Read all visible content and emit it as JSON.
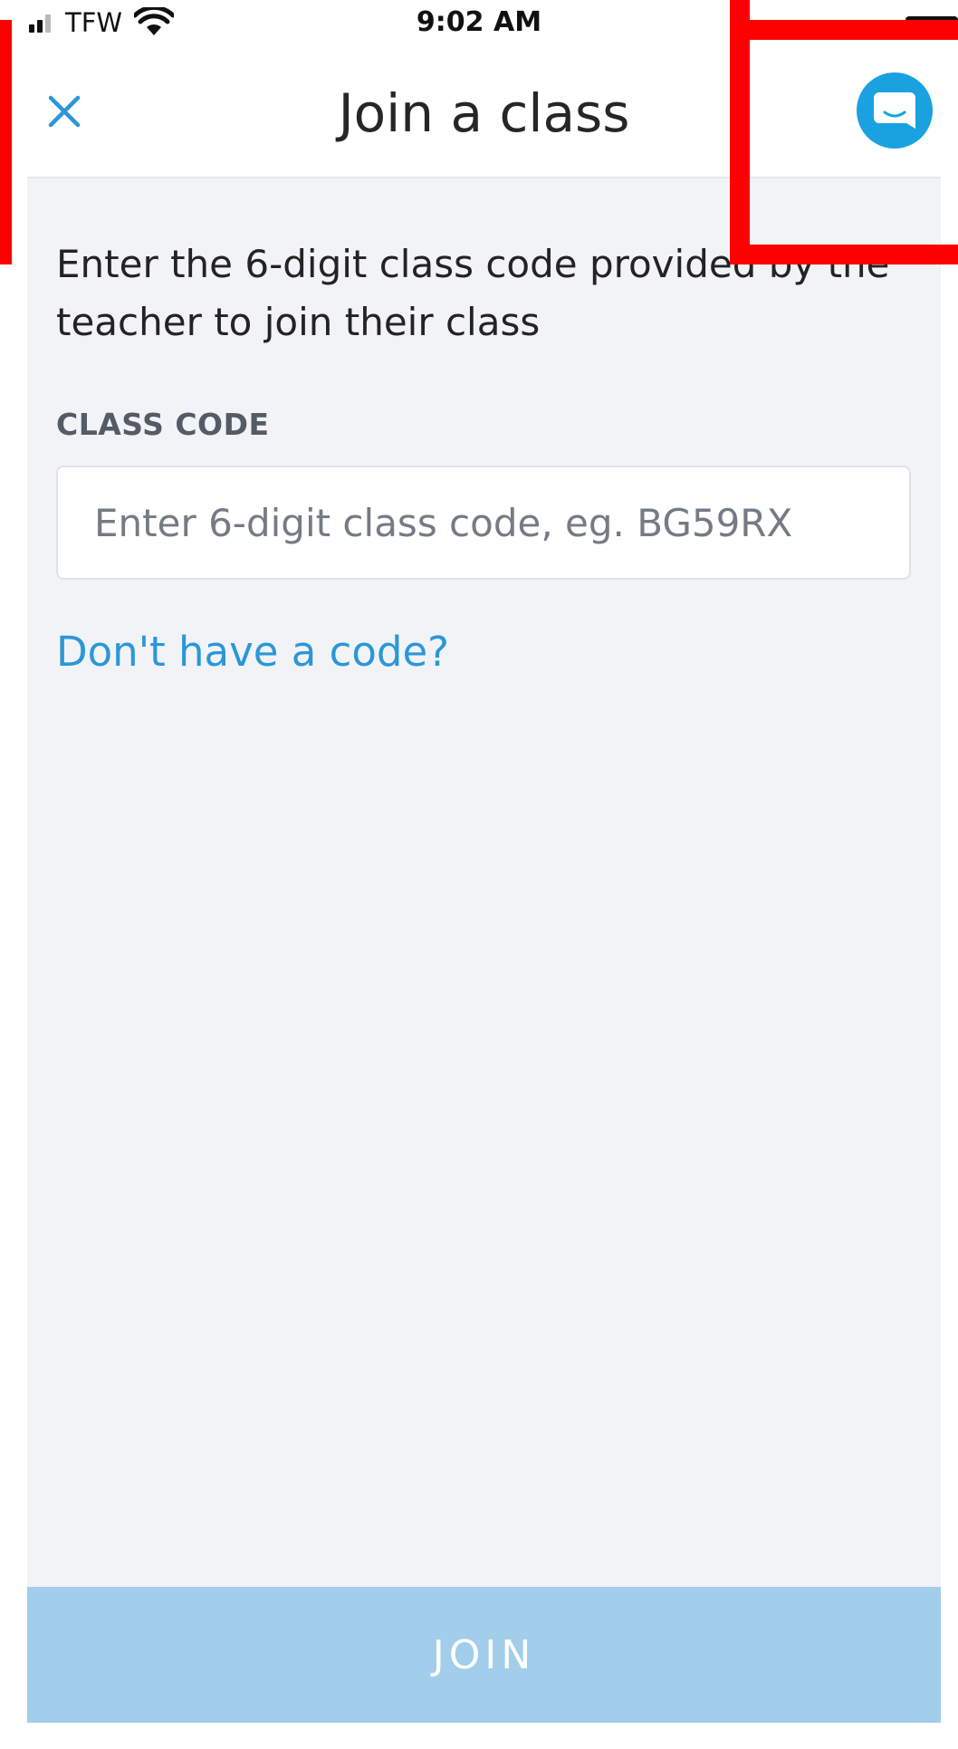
{
  "status_bar": {
    "carrier": "TFW",
    "time": "9:02 AM"
  },
  "nav": {
    "title": "Join a class",
    "close_icon": "close-icon",
    "chat_icon": "chat-icon"
  },
  "content": {
    "instructions": "Enter the 6-digit class code provided by the teacher to join their class",
    "field_label": "CLASS CODE",
    "input_value": "",
    "input_placeholder": "Enter 6-digit class code, eg. BG59RX",
    "no_code_link": "Don't have a code?"
  },
  "footer": {
    "join_label": "JOIN"
  },
  "colors": {
    "accent": "#2b97d8",
    "chat_button": "#1aa2e0",
    "join_disabled": "#a2cdeb",
    "background": "#f2f3f7",
    "annotation": "#ff0000"
  }
}
